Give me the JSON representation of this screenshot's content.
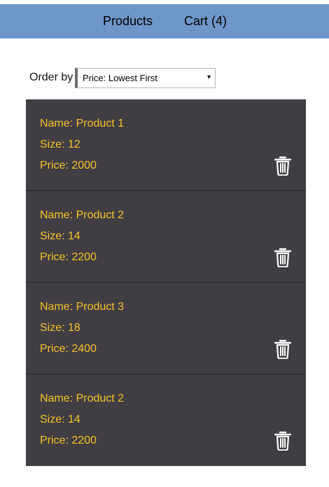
{
  "nav": {
    "items": [
      {
        "label": "Products"
      },
      {
        "label": "Cart (4)"
      }
    ]
  },
  "filter": {
    "label": "Order by",
    "selected": "Price: Lowest First",
    "arrow": "▾"
  },
  "products": [
    {
      "name": "Name: Product 1",
      "size": "Size: 12",
      "price": "Price: 2000",
      "delete_icon": "trash-icon"
    },
    {
      "name": "Name: Product 2",
      "size": "Size: 14",
      "price": "Price: 2200",
      "delete_icon": "trash-icon"
    },
    {
      "name": "Name: Product 3",
      "size": "Size: 18",
      "price": "Price: 2400",
      "delete_icon": "trash-icon"
    },
    {
      "name": "Name: Product 2",
      "size": "Size: 14",
      "price": "Price: 2200",
      "delete_icon": "trash-icon"
    }
  ],
  "colors": {
    "navbar": "#6f96c9",
    "list_background": "#413e43",
    "product_text": "#f5c22b",
    "icon": "#ffffff"
  }
}
